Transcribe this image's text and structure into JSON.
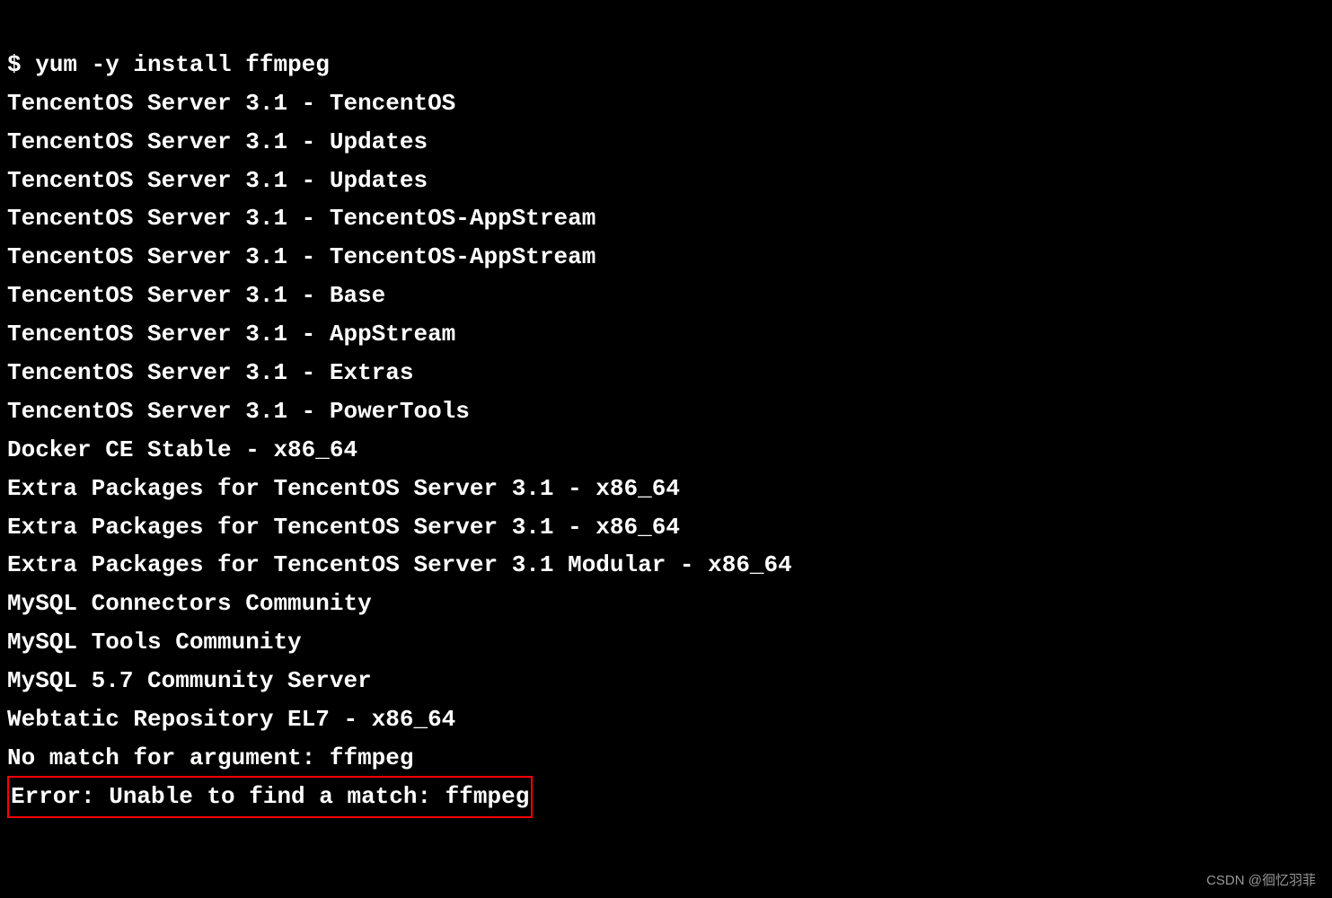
{
  "terminal": {
    "prompt": "$",
    "command": "yum -y install ffmpeg",
    "output_lines": [
      "TencentOS Server 3.1 - TencentOS",
      "TencentOS Server 3.1 - Updates",
      "TencentOS Server 3.1 - Updates",
      "TencentOS Server 3.1 - TencentOS-AppStream",
      "TencentOS Server 3.1 - TencentOS-AppStream",
      "TencentOS Server 3.1 - Base",
      "TencentOS Server 3.1 - AppStream",
      "TencentOS Server 3.1 - Extras",
      "TencentOS Server 3.1 - PowerTools",
      "Docker CE Stable - x86_64",
      "Extra Packages for TencentOS Server 3.1 - x86_64",
      "Extra Packages for TencentOS Server 3.1 - x86_64",
      "Extra Packages for TencentOS Server 3.1 Modular - x86_64",
      "MySQL Connectors Community",
      "MySQL Tools Community",
      "MySQL 5.7 Community Server",
      "Webtatic Repository EL7 - x86_64"
    ],
    "no_match_prefix": "No match for argument: ",
    "no_match_arg": "ffmpeg",
    "error_line": "Error: Unable to find a match: ffmpeg"
  },
  "watermark": "CSDN @徊忆羽菲"
}
